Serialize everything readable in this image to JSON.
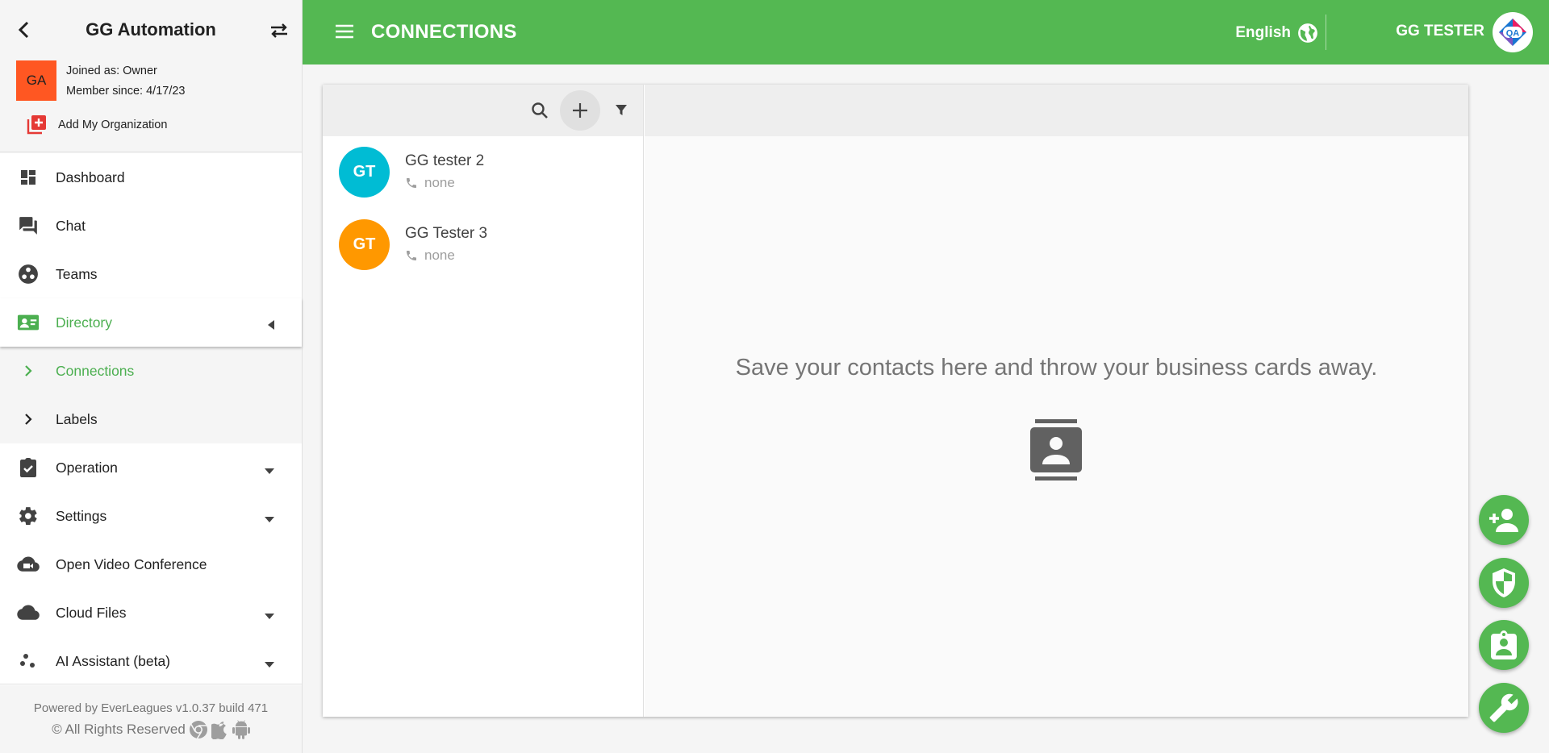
{
  "sidebar": {
    "org_title": "GG Automation",
    "org_avatar": "GA",
    "joined": "Joined as: Owner",
    "member_since": "Member since: 4/17/23",
    "add_org": "Add My Organization",
    "nav": {
      "dashboard": "Dashboard",
      "chat": "Chat",
      "teams": "Teams",
      "directory": "Directory",
      "connections": "Connections",
      "labels": "Labels",
      "operation": "Operation",
      "settings": "Settings",
      "video": "Open Video Conference",
      "cloud": "Cloud Files",
      "ai": "AI Assistant (beta)"
    },
    "footer": {
      "powered": "Powered by EverLeagues v1.0.37 build 471",
      "rights": "© All Rights Reserved"
    }
  },
  "topbar": {
    "title": "CONNECTIONS",
    "language": "English",
    "user": "GG TESTER",
    "logo_text": "QA"
  },
  "contacts": [
    {
      "initials": "GT",
      "name": "GG tester 2",
      "phone": "none",
      "color": "#00bcd4"
    },
    {
      "initials": "GT",
      "name": "GG Tester 3",
      "phone": "none",
      "color": "#ff9800"
    }
  ],
  "detail": {
    "empty_message": "Save your contacts here and throw your business cards away."
  },
  "colors": {
    "brand_green": "#54b852",
    "active_green": "#4caf50",
    "org_avatar": "#ff5722"
  }
}
